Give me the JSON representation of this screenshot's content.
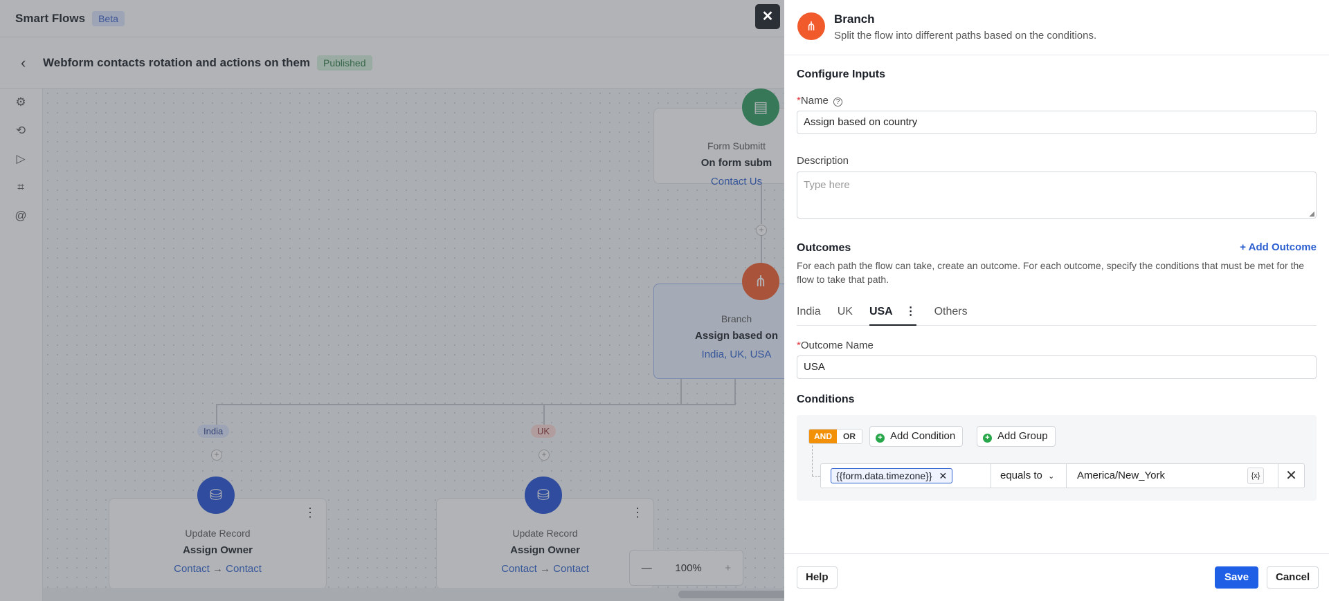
{
  "app": {
    "title": "Smart Flows",
    "badge": "Beta"
  },
  "flow": {
    "back_icon": "chevron-left-icon",
    "title": "Webform contacts rotation and actions on them",
    "status": "Published"
  },
  "rail": {
    "icons": [
      "gear-icon",
      "history-icon",
      "play-flow-icon",
      "scan-icon",
      "at-sign-icon"
    ]
  },
  "canvas": {
    "trigger": {
      "type": "Form Submitt",
      "name": "On form subm",
      "sub": "Contact Us",
      "color": "#2e9a5f"
    },
    "branch": {
      "type": "Branch",
      "name": "Assign based on",
      "sub": "India, UK, USA",
      "color": "#f15b2c"
    },
    "path_labels": [
      "India",
      "UK"
    ],
    "actions": [
      {
        "type": "Update Record",
        "name": "Assign Owner",
        "from": "Contact",
        "arrow": "→",
        "to": "Contact"
      },
      {
        "type": "Update Record",
        "name": "Assign Owner",
        "from": "Contact",
        "arrow": "→",
        "to": "Contact"
      }
    ],
    "zoom": {
      "minus": "—",
      "level": "100%",
      "plus": "+"
    }
  },
  "panel": {
    "title": "Branch",
    "description": "Split the flow into different paths based on the conditions.",
    "configure_heading": "Configure Inputs",
    "name_label": "Name",
    "name_value": "Assign based on country",
    "description_label": "Description",
    "description_placeholder": "Type here",
    "outcomes_heading": "Outcomes",
    "add_outcome": "Add Outcome",
    "outcomes_help": "For each path the flow can take, create an outcome. For each outcome, specify the conditions that must be met for the flow to take that path.",
    "tabs": [
      "India",
      "UK",
      "USA",
      "Others"
    ],
    "active_tab": "USA",
    "outcome_name_label": "Outcome Name",
    "outcome_name_value": "USA",
    "conditions_heading": "Conditions",
    "logic": {
      "and": "AND",
      "or": "OR"
    },
    "add_condition": "Add Condition",
    "add_group": "Add Group",
    "condition": {
      "variable": "{{form.data.timezone}}",
      "operator": "equals to",
      "value": "America/New_York",
      "fx": "{x}"
    },
    "footer": {
      "help": "Help",
      "save": "Save",
      "cancel": "Cancel"
    },
    "accent": "#1f5fe6"
  }
}
